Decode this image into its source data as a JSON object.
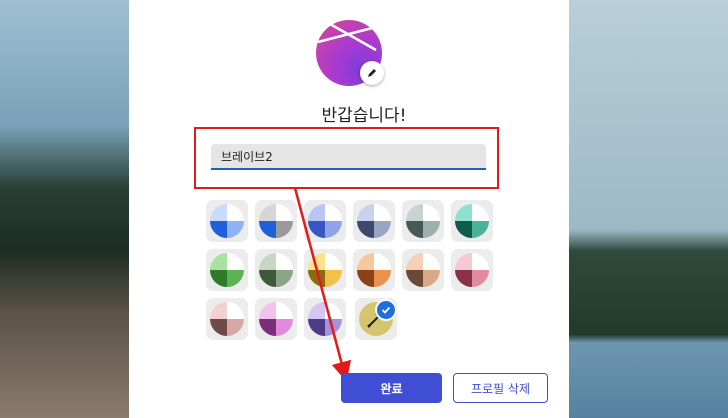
{
  "greeting": "반갑습니다!",
  "name_field": {
    "value": "브레이브2"
  },
  "buttons": {
    "done_label": "완료",
    "delete_label": "프로필 삭제"
  },
  "accent_color": "#3f4ed4",
  "highlight_color": "#e11a1a",
  "swatches": [
    {
      "name": "color-swatch-blue",
      "colors": [
        "#c9dbff",
        "#ffffff",
        "#1f5fd9",
        "#8fb3f2"
      ]
    },
    {
      "name": "color-swatch-gray-blue",
      "colors": [
        "#d6d6d6",
        "#ffffff",
        "#1f5fd9",
        "#9a9a9a"
      ]
    },
    {
      "name": "color-swatch-periwinkle",
      "colors": [
        "#b8c6f7",
        "#ffffff",
        "#3656c5",
        "#8ea3e8"
      ]
    },
    {
      "name": "color-swatch-slate",
      "colors": [
        "#c9d3ee",
        "#ffffff",
        "#3e4a6d",
        "#9aa5c4"
      ]
    },
    {
      "name": "color-swatch-sage-gray",
      "colors": [
        "#c9d3d1",
        "#ffffff",
        "#465955",
        "#9eb0ac"
      ]
    },
    {
      "name": "color-swatch-teal",
      "colors": [
        "#8fe0cf",
        "#ffffff",
        "#0d5b4b",
        "#49b29b"
      ]
    },
    {
      "name": "color-swatch-green",
      "colors": [
        "#a9e2a0",
        "#ffffff",
        "#2f7a2a",
        "#5db256"
      ]
    },
    {
      "name": "color-swatch-moss",
      "colors": [
        "#c9d6c4",
        "#ffffff",
        "#3e5a3a",
        "#8ca587"
      ]
    },
    {
      "name": "color-swatch-yellow",
      "colors": [
        "#fbe28a",
        "#ffffff",
        "#8b6a12",
        "#f0c24c"
      ]
    },
    {
      "name": "color-swatch-orange",
      "colors": [
        "#f8c79e",
        "#ffffff",
        "#8a4318",
        "#e9924e"
      ]
    },
    {
      "name": "color-swatch-peach",
      "colors": [
        "#f5cfb6",
        "#ffffff",
        "#6a4a37",
        "#d8a887"
      ]
    },
    {
      "name": "color-swatch-pink",
      "colors": [
        "#f6c8d1",
        "#ffffff",
        "#8a3347",
        "#e48aa0"
      ]
    },
    {
      "name": "color-swatch-rose",
      "colors": [
        "#f5d0d0",
        "#ffffff",
        "#6e4a4a",
        "#d7a8a8"
      ]
    },
    {
      "name": "color-swatch-magenta",
      "colors": [
        "#f2c1ee",
        "#ffffff",
        "#7a2f78",
        "#e08add"
      ]
    },
    {
      "name": "color-swatch-lavender",
      "colors": [
        "#d6c6f3",
        "#ffffff",
        "#4c3b86",
        "#a592dc"
      ]
    }
  ]
}
